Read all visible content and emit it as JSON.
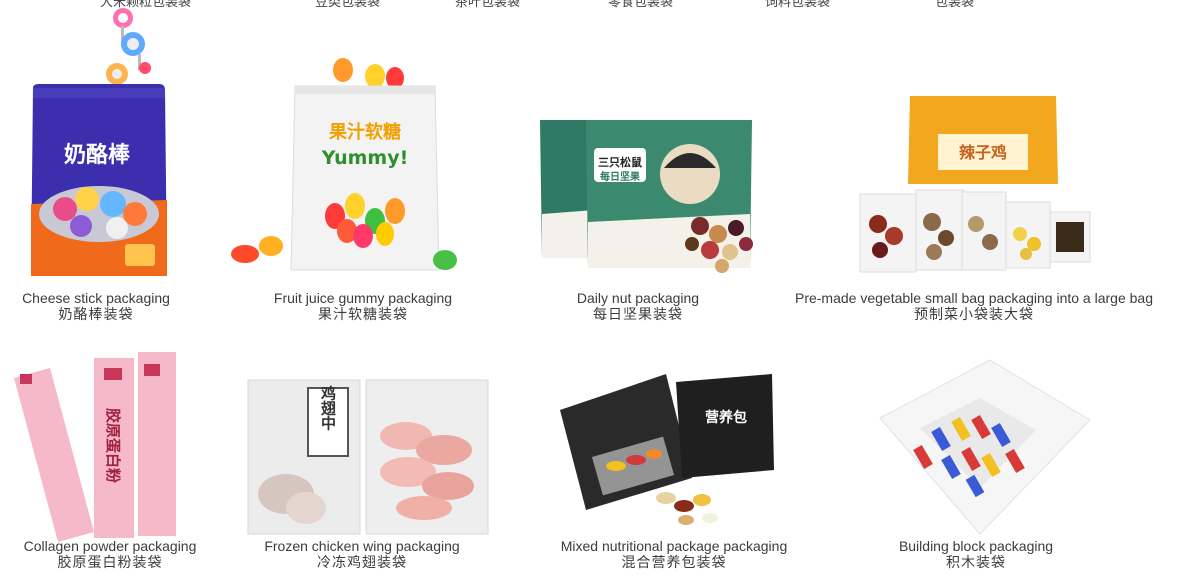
{
  "top_row_cutoff": [
    "大米颗粒包装袋",
    "豆类包装袋",
    "茶叶包装袋",
    "零食包装袋",
    "饲料包装袋",
    "包装袋"
  ],
  "products": [
    {
      "en": "Cheese stick packaging",
      "cn": "奶酪棒装袋",
      "pack_text": "奶酪棒"
    },
    {
      "en": "Fruit juice gummy packaging",
      "cn": "果汁软糖装袋",
      "pack_text": "果汁软糖",
      "pack_text2": "Yummy!"
    },
    {
      "en": "Daily nut packaging",
      "cn": "每日坚果装袋",
      "pack_text": "三只松鼠",
      "pack_text2": "每日坚果"
    },
    {
      "en": "Pre-made vegetable small bag packaging into a large bag",
      "cn": "预制菜小袋装大袋",
      "pack_text": "辣子鸡"
    },
    {
      "en": "Collagen powder packaging",
      "cn": "胶原蛋白粉装袋",
      "pack_text": "胶原蛋白粉"
    },
    {
      "en": "Frozen chicken wing packaging",
      "cn": "冷冻鸡翅装袋",
      "pack_text": "鸡翅中"
    },
    {
      "en": "Mixed nutritional package packaging",
      "cn": "混合营养包装袋",
      "pack_text": "营养包"
    },
    {
      "en": "Building block packaging",
      "cn": "积木装袋"
    }
  ]
}
